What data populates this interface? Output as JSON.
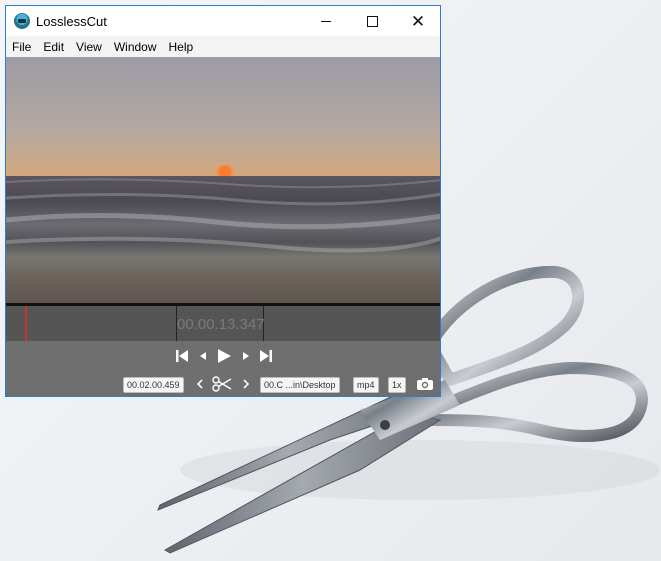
{
  "window": {
    "title": "LosslessCut",
    "icon": "losslesscut-app-icon"
  },
  "menu": {
    "items": [
      "File",
      "Edit",
      "View",
      "Window",
      "Help"
    ]
  },
  "player": {
    "current_time": "00.00.13.347",
    "duration": "00.02.00.459",
    "output_dir": "00.C ...in\\Desktop",
    "format": "mp4",
    "speed": "1x"
  },
  "icons": {
    "skip_start": "skip-to-start-icon",
    "prev_frame": "previous-frame-icon",
    "play": "play-icon",
    "next_frame": "next-frame-icon",
    "skip_end": "skip-to-end-icon",
    "cut_start": "set-cut-start-icon",
    "cut": "scissors-icon",
    "cut_end": "set-cut-end-icon",
    "screenshot": "camera-icon"
  },
  "colors": {
    "window_border": "#2b7bd8",
    "timeline_bg": "#555555",
    "controls_bg": "#6e6e6e",
    "playhead": "#c0392b"
  }
}
